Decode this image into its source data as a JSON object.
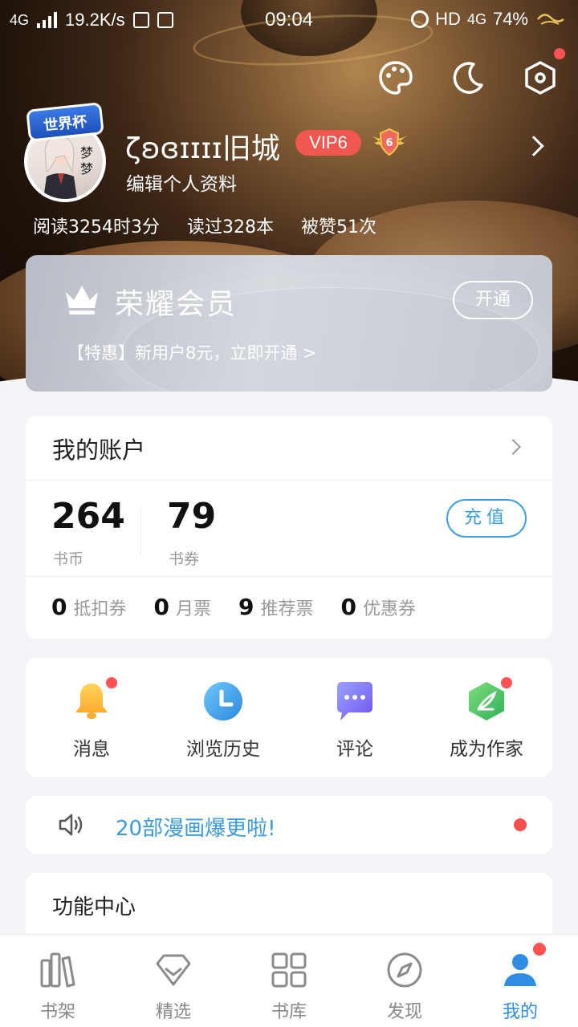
{
  "status_bar": {
    "network": "4G",
    "speed": "19.2K/s",
    "time": "09:04",
    "hd": "HD",
    "network_right": "4G",
    "battery": "74%"
  },
  "profile": {
    "avatar_badge": "世界杯",
    "username": "ζʚɞɪɪɪɪ旧城",
    "vip_label": "VIP6",
    "level": "6",
    "edit_label": "编辑个人资料",
    "stats": [
      "阅读3254时3分",
      "读过328本",
      "被赞51次"
    ]
  },
  "vip_card": {
    "title": "荣耀会员",
    "button": "开通",
    "promo": "【特惠】新用户8元，立即开通 >"
  },
  "account": {
    "title": "我的账户",
    "coins_value": "264",
    "coins_label": "书币",
    "vouchers_value": "79",
    "vouchers_label": "书券",
    "recharge": "充值",
    "tickets": [
      {
        "value": "0",
        "label": "抵扣券"
      },
      {
        "value": "0",
        "label": "月票"
      },
      {
        "value": "9",
        "label": "推荐票"
      },
      {
        "value": "0",
        "label": "优惠券"
      }
    ]
  },
  "quick_actions": [
    {
      "label": "消息",
      "icon": "bell-icon",
      "dot": true
    },
    {
      "label": "浏览历史",
      "icon": "clock-icon",
      "dot": false
    },
    {
      "label": "评论",
      "icon": "comment-icon",
      "dot": false
    },
    {
      "label": "成为作家",
      "icon": "feather-icon",
      "dot": true
    }
  ],
  "notice": {
    "text": "20部漫画爆更啦!"
  },
  "function_center": {
    "title": "功能中心"
  },
  "tabs": [
    {
      "label": "书架",
      "icon": "bookshelf-icon"
    },
    {
      "label": "精选",
      "icon": "diamond-icon"
    },
    {
      "label": "书库",
      "icon": "grid-icon"
    },
    {
      "label": "发现",
      "icon": "compass-icon"
    },
    {
      "label": "我的",
      "icon": "user-icon",
      "active": true
    }
  ],
  "colors": {
    "accent": "#2f8de4",
    "vip_red": "#f0574f",
    "notice_blue": "#3a9ae0",
    "red_dot": "#ff5252"
  }
}
